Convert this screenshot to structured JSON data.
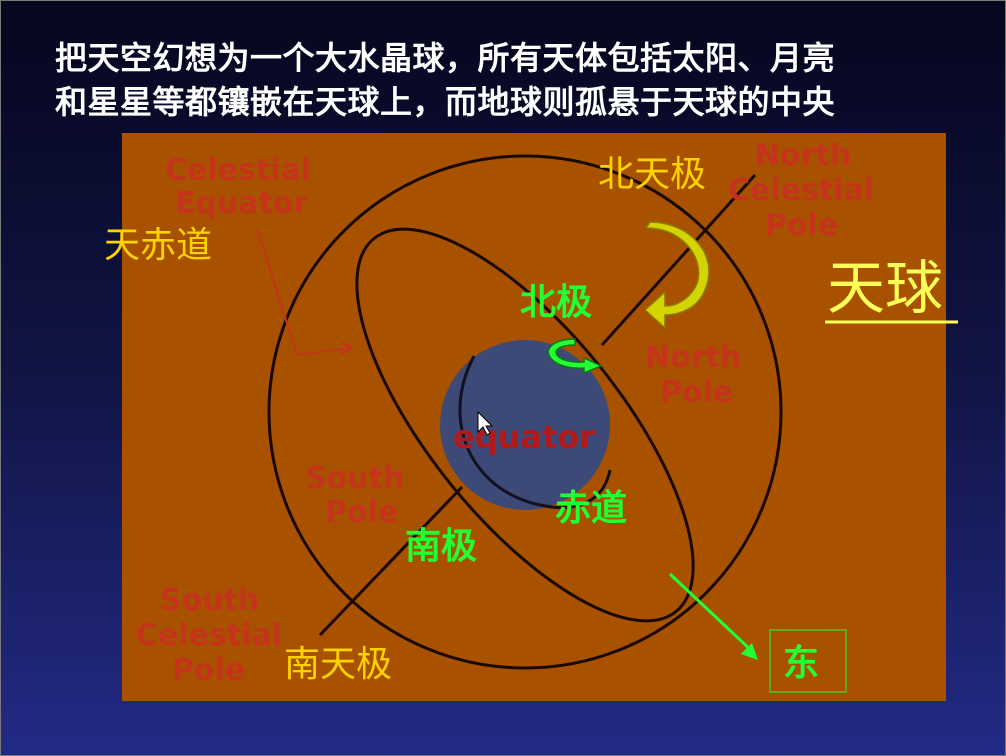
{
  "title": {
    "line1": "把天空幻想为一个大水晶球，所有天体包括太阳、月亮",
    "line2": "和星星等都镶嵌在天球上，而地球则孤悬于天球的中央"
  },
  "diagram": {
    "en": {
      "celestial_equator_1": "Celestial",
      "celestial_equator_2": "Equator",
      "north_celestial_pole_1": "North",
      "north_celestial_pole_2": "Celestial",
      "north_celestial_pole_3": "Pole",
      "north_pole_1": "North",
      "north_pole_2": "Pole",
      "south_pole_1": "South",
      "south_pole_2": "Pole",
      "south_celestial_pole_1": "South",
      "south_celestial_pole_2": "Celestial",
      "south_celestial_pole_3": "Pole",
      "equator": "equator"
    },
    "cn": {
      "north_celestial_pole": "北天极",
      "celestial_equator": "天赤道",
      "north_pole": "北极",
      "equator": "赤道",
      "south_pole": "南极",
      "south_celestial_pole": "南天极",
      "celestial_sphere": "天球",
      "east": "东"
    },
    "colors": {
      "panel": "#a85200",
      "earth": "#3d4a78",
      "english_labels": "#c4341a",
      "yellow_labels": "#ffd200",
      "green_labels": "#22ff33",
      "arrow_yellow": "#d4d400",
      "arrow_green": "#22ff33"
    }
  }
}
